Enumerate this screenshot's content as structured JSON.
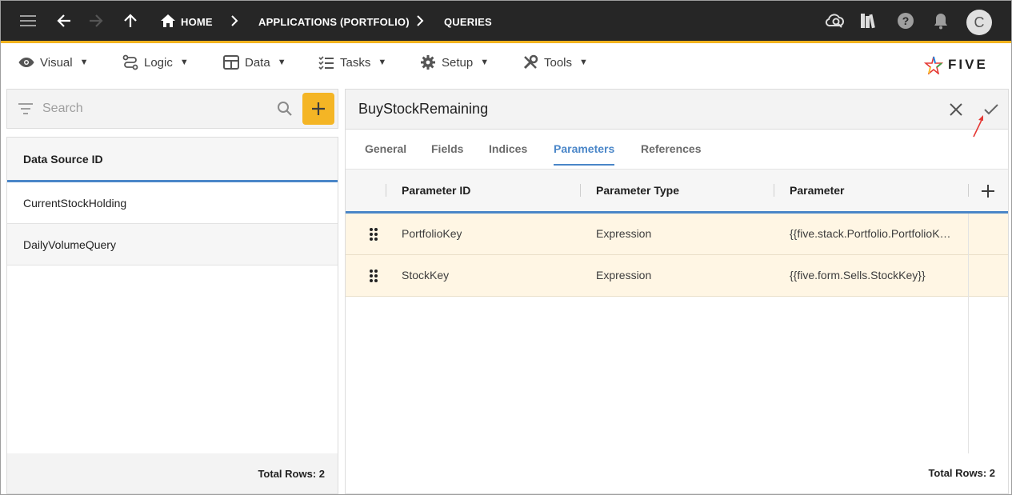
{
  "breadcrumb": {
    "home": "HOME",
    "applications": "APPLICATIONS (PORTFOLIO)",
    "queries": "QUERIES"
  },
  "user": {
    "avatar_initial": "C"
  },
  "menu": {
    "visual": "Visual",
    "logic": "Logic",
    "data": "Data",
    "tasks": "Tasks",
    "setup": "Setup",
    "tools": "Tools",
    "caret": "▼"
  },
  "brand": {
    "name": "FIVE"
  },
  "search": {
    "placeholder": "Search"
  },
  "left_list": {
    "header": "Data Source ID",
    "rows": [
      "CurrentStockHolding",
      "DailyVolumeQuery"
    ],
    "total": "Total Rows: 2"
  },
  "form": {
    "title": "BuyStockRemaining",
    "tabs": [
      "General",
      "Fields",
      "Indices",
      "Parameters",
      "References"
    ],
    "active_tab": "Parameters",
    "columns": [
      "Parameter ID",
      "Parameter Type",
      "Parameter"
    ],
    "rows": [
      {
        "id": "PortfolioKey",
        "type": "Expression",
        "parameter": "{{five.stack.Portfolio.PortfolioK…"
      },
      {
        "id": "StockKey",
        "type": "Expression",
        "parameter": "{{five.form.Sells.StockKey}}"
      }
    ],
    "total": "Total Rows: 2"
  },
  "colors": {
    "accent": "#f4b525",
    "active_tab": "#4a86c8",
    "row_highlight": "#fff6e4",
    "topbar": "#262626"
  }
}
